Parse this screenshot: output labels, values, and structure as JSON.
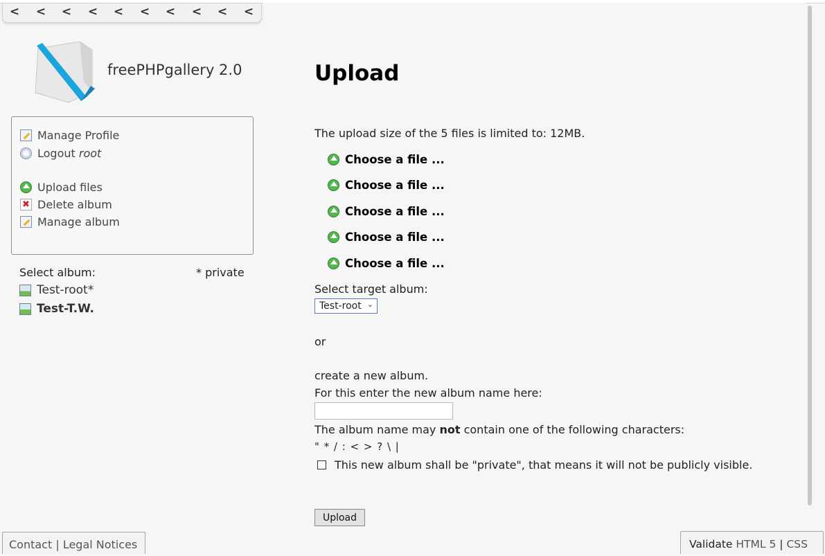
{
  "app": {
    "title": "freePHPgallery 2.0"
  },
  "arrowbar": {
    "arrows": [
      "<",
      "<",
      "<",
      "<",
      "<",
      "<",
      "<",
      "<",
      "<",
      "<"
    ]
  },
  "menu": {
    "manage_profile": "Manage Profile",
    "logout_prefix": "Logout ",
    "logout_user": "root",
    "upload_files": "Upload files",
    "delete_album": "Delete album",
    "manage_album": "Manage album"
  },
  "albums": {
    "select_label": "Select album:",
    "private_note": "* private",
    "items": [
      {
        "label": "Test-root*",
        "bold": false
      },
      {
        "label": "Test-T.W.",
        "bold": true
      }
    ]
  },
  "footer_left": {
    "contact": "Contact",
    "separator": "|",
    "legal": "Legal Notices"
  },
  "footer_right": {
    "validate": "Validate",
    "html5": "HTML 5",
    "separator": "|",
    "css": "CSS"
  },
  "main": {
    "title": "Upload",
    "limit_text": "The upload size of the 5 files is limited to: 12MB.",
    "choose_file_labels": [
      "Choose a file ...",
      "Choose a file ...",
      "Choose a file ...",
      "Choose a file ...",
      "Choose a file ..."
    ],
    "target_label": "Select target album:",
    "target_selected": "Test-root",
    "or_text": "or",
    "create_text": "create a new album.",
    "enter_text": "For this enter the new album name here:",
    "new_album_value": "",
    "warning_prefix": "The album name may ",
    "warning_bold": "not",
    "warning_suffix": " contain one of the following characters:",
    "forbidden_chars": "\" * / : < > ? \\ |",
    "private_checkbox_label": "This new album shall be \"private\", that means it will not be publicly visible.",
    "private_checked": false,
    "upload_button": "Upload"
  },
  "colors": {
    "accent_green": "#54b750",
    "select_border": "#5c74c3",
    "logo_blue": "#1aa6dc"
  },
  "icons": {
    "profile": "edit-icon",
    "logout": "logout-icon",
    "upload": "upload-icon",
    "delete": "delete-icon",
    "album": "album-icon",
    "choose": "upload-arrow-icon"
  }
}
